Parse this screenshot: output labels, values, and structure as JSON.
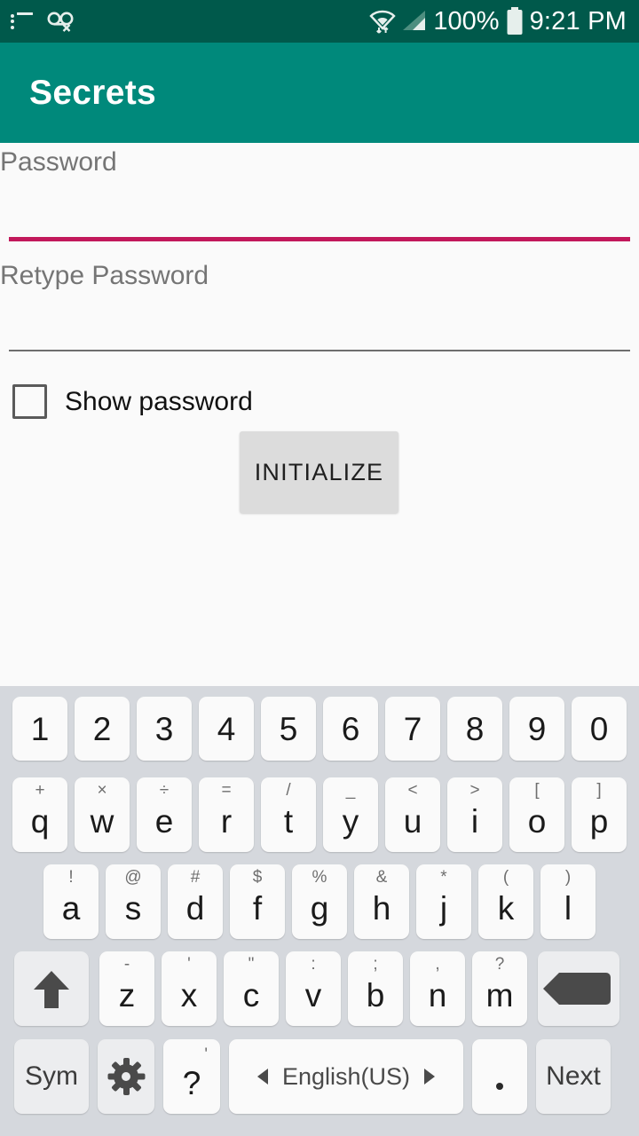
{
  "status_bar": {
    "background": "#00594B",
    "left_icons": [
      {
        "name": "list-icon",
        "glyph": "list"
      },
      {
        "name": "voicemail-off-icon",
        "glyph": "voicemail-off"
      }
    ],
    "right_icons": [
      {
        "name": "wifi-icon",
        "glyph": "wifi"
      },
      {
        "name": "cellular-signal-icon",
        "glyph": "signal"
      },
      {
        "name": "battery-icon",
        "glyph": "battery-full"
      }
    ],
    "battery_percent": "100%",
    "time": "9:21 PM"
  },
  "app_bar": {
    "title": "Secrets",
    "background": "#00897B",
    "title_color": "#FFFFFF"
  },
  "form": {
    "accent_color": "#C2185B",
    "fields": [
      {
        "name": "password-field",
        "label": "Password",
        "value": "",
        "focused": true,
        "underline_color": "#C2185B"
      },
      {
        "name": "retype-password-field",
        "label": "Retype Password",
        "value": "",
        "focused": false,
        "underline_color": "#6E6E6E"
      }
    ],
    "checkbox": {
      "label": "Show password",
      "checked": false
    },
    "button": {
      "label": "INITIALIZE",
      "background": "#DCDCDC",
      "enabled": true
    }
  },
  "keyboard": {
    "background": "#D5D8DD",
    "key_color": "#FAFAFA",
    "modifier_key_color": "#ECEDEF",
    "language": "English(US)",
    "rows": {
      "numbers": [
        {
          "main": "1"
        },
        {
          "main": "2"
        },
        {
          "main": "3"
        },
        {
          "main": "4"
        },
        {
          "main": "5"
        },
        {
          "main": "6"
        },
        {
          "main": "7"
        },
        {
          "main": "8"
        },
        {
          "main": "9"
        },
        {
          "main": "0"
        }
      ],
      "top": [
        {
          "main": "q",
          "sup": "+"
        },
        {
          "main": "w",
          "sup": "×"
        },
        {
          "main": "e",
          "sup": "÷"
        },
        {
          "main": "r",
          "sup": "="
        },
        {
          "main": "t",
          "sup": "/"
        },
        {
          "main": "y",
          "sup": "_"
        },
        {
          "main": "u",
          "sup": "<"
        },
        {
          "main": "i",
          "sup": ">"
        },
        {
          "main": "o",
          "sup": "["
        },
        {
          "main": "p",
          "sup": "]"
        }
      ],
      "home": [
        {
          "main": "a",
          "sup": "!"
        },
        {
          "main": "s",
          "sup": "@"
        },
        {
          "main": "d",
          "sup": "#"
        },
        {
          "main": "f",
          "sup": "$"
        },
        {
          "main": "g",
          "sup": "%"
        },
        {
          "main": "h",
          "sup": "&"
        },
        {
          "main": "j",
          "sup": "*"
        },
        {
          "main": "k",
          "sup": "("
        },
        {
          "main": "l",
          "sup": ")"
        }
      ],
      "bottom": [
        {
          "main": "z",
          "sup": "-"
        },
        {
          "main": "x",
          "sup": "'"
        },
        {
          "main": "c",
          "sup": "\""
        },
        {
          "main": "v",
          "sup": ":"
        },
        {
          "main": "b",
          "sup": ";"
        },
        {
          "main": "n",
          "sup": ","
        },
        {
          "main": "m",
          "sup": "?"
        }
      ],
      "function": {
        "sym_label": "Sym",
        "settings_icon": "gear-icon",
        "question_label": "?",
        "question_sup": "'",
        "space_label": "English(US)",
        "period_label": ".",
        "next_label": "Next"
      },
      "shift_icon": "shift-arrow-icon",
      "backspace_icon": "backspace-icon",
      "backspace_glyph": "×"
    }
  }
}
